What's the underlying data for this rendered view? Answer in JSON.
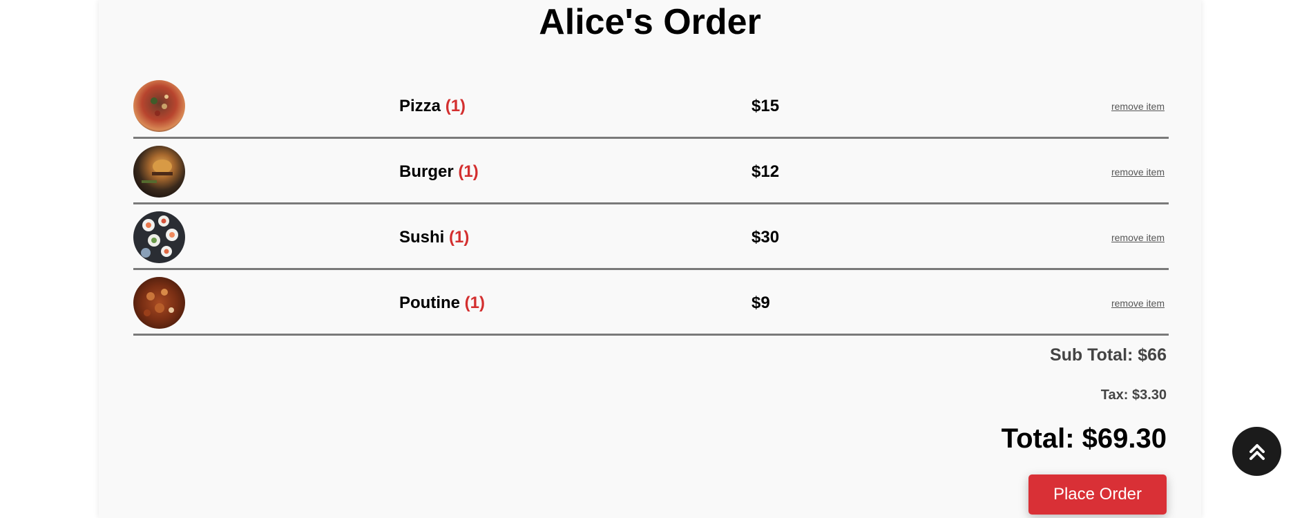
{
  "order": {
    "title": "Alice's Order",
    "items": [
      {
        "name": "Pizza",
        "qty": "(1)",
        "price": "$15",
        "remove_label": "remove item",
        "image_icon": "pizza-photo"
      },
      {
        "name": "Burger",
        "qty": "(1)",
        "price": "$12",
        "remove_label": "remove item",
        "image_icon": "burger-photo"
      },
      {
        "name": "Sushi",
        "qty": "(1)",
        "price": "$30",
        "remove_label": "remove item",
        "image_icon": "sushi-photo"
      },
      {
        "name": "Poutine",
        "qty": "(1)",
        "price": "$9",
        "remove_label": "remove item",
        "image_icon": "poutine-photo"
      }
    ],
    "subtotal": "Sub Total: $66",
    "tax": "Tax: $3.30",
    "total": "Total: $69.30",
    "place_order_label": "Place Order"
  },
  "colors": {
    "accent": "#d93036",
    "quantity": "#d32f2f",
    "divider": "#7a7a7a",
    "card_background": "#f9f9f9",
    "scroll_button": "#1b1b1b"
  },
  "scroll_top": {
    "icon": "double-chevron-up-icon"
  }
}
